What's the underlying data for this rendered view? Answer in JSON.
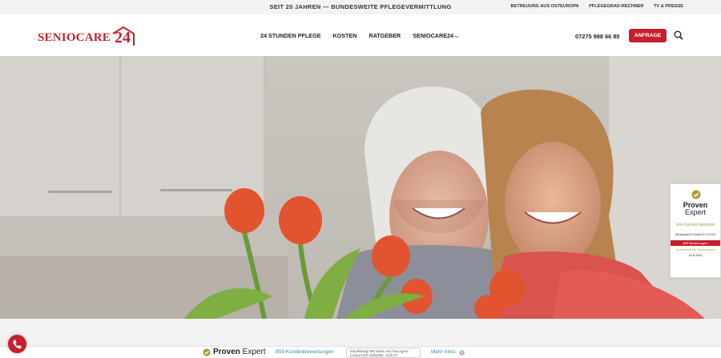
{
  "topbar": {
    "tagline": "SEIT 20 JAHREN — BUNDESWEITE PFLEGEVERMITTLUNG",
    "links": [
      "BETREUUNG AUS OSTEUROPA",
      "PFLEGEGRAD-RECHNER",
      "TV & PRESSE"
    ]
  },
  "header": {
    "logo_word": "SENIOCARE",
    "logo_num": "24",
    "nav": [
      "24 STUNDEN PFLEGE",
      "KOSTEN",
      "RATGEBER",
      "SENIOCARE24"
    ],
    "phone": "07275 988 66 80",
    "cta": "ANFRAGE"
  },
  "widget": {
    "line1": "Proven",
    "line2": "Expert",
    "rated": "Von Kunden bewertet",
    "company": "Seniocare24 GmbH & CO KG",
    "count": "859 Bewertungen",
    "score": "Zu Echtheit der Bewertungen",
    "date": "19.6.2025"
  },
  "bottom": {
    "logo_bold": "Proven",
    "logo_light": " Expert",
    "reviews": "859 Kundenbewertungen",
    "quote": "Empfehlung! Wir waren mit Frau Agnes Lucona sehr zufrieden. Auch ins",
    "more": "Mehr Infos"
  },
  "colors": {
    "brand": "#c61f2f",
    "link": "#2a8fb5",
    "gold": "#b1983a"
  }
}
